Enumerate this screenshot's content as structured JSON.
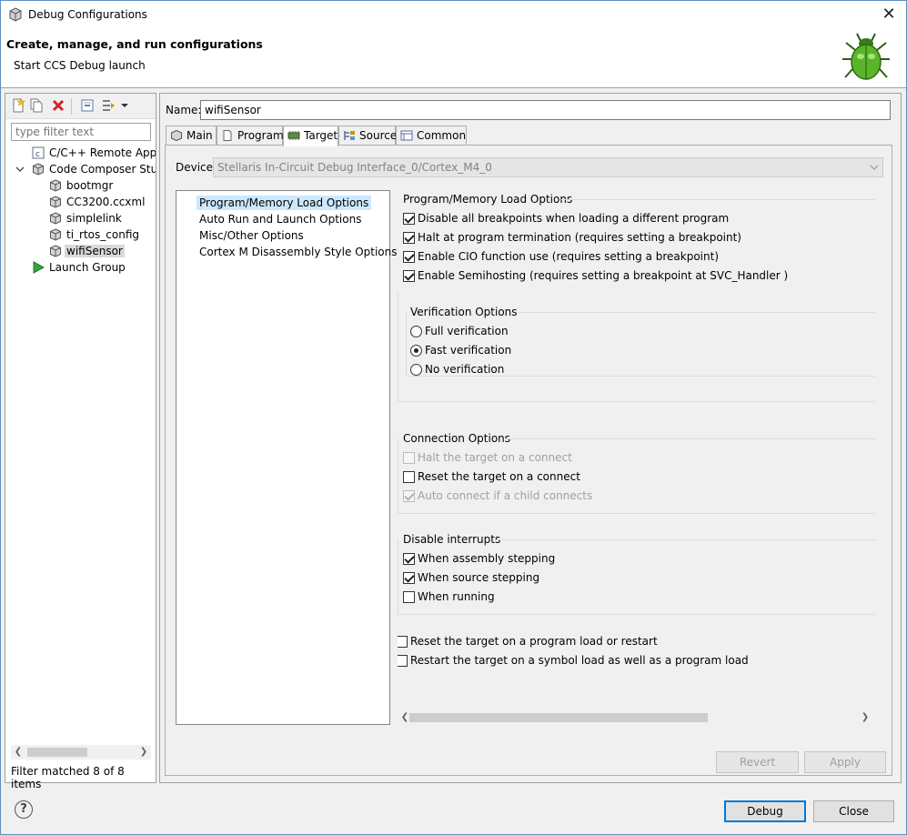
{
  "window": {
    "title": "Debug Configurations",
    "close_label": "✕"
  },
  "header": {
    "title": "Create, manage, and run configurations",
    "subtitle": "Start CCS Debug launch"
  },
  "left": {
    "filter_placeholder": "type filter text",
    "tree": [
      {
        "label": "C/C++ Remote Appli",
        "icon": "c-file-icon"
      },
      {
        "label": "Code Composer Stuc",
        "icon": "cube-icon",
        "expanded": true
      },
      {
        "label": "bootmgr",
        "icon": "cube-small-icon"
      },
      {
        "label": "CC3200.ccxml",
        "icon": "cube-small-icon"
      },
      {
        "label": "simplelink",
        "icon": "cube-small-icon"
      },
      {
        "label": "ti_rtos_config",
        "icon": "cube-small-icon"
      },
      {
        "label": "wifiSensor",
        "icon": "cube-small-icon",
        "selected": true
      },
      {
        "label": "Launch Group",
        "icon": "play-icon"
      }
    ],
    "status": "Filter matched 8 of 8 items"
  },
  "config": {
    "name_label": "Name:",
    "name_value": "wifiSensor",
    "tabs": [
      {
        "label": "Main"
      },
      {
        "label": "Program"
      },
      {
        "label": "Target",
        "active": true
      },
      {
        "label": "Source"
      },
      {
        "label": "Common"
      }
    ],
    "device_label": "Device",
    "device_value": "Stellaris In-Circuit Debug Interface_0/Cortex_M4_0",
    "option_categories": [
      "Program/Memory Load Options",
      "Auto Run and Launch Options",
      "Misc/Other Options",
      "Cortex M Disassembly Style Options"
    ],
    "load_group": {
      "title": "Program/Memory Load Options",
      "items": [
        {
          "label": "Disable all breakpoints when loading a different program",
          "checked": true
        },
        {
          "label": "Halt at program termination (requires setting a breakpoint)",
          "checked": true
        },
        {
          "label": "Enable CIO function use (requires setting a breakpoint)",
          "checked": true
        },
        {
          "label": "Enable Semihosting (requires setting a breakpoint at SVC_Handler )",
          "checked": true
        }
      ]
    },
    "verification": {
      "title": "Verification Options",
      "items": [
        {
          "label": "Full verification",
          "checked": false
        },
        {
          "label": "Fast verification",
          "checked": true
        },
        {
          "label": "No verification",
          "checked": false
        }
      ]
    },
    "connection": {
      "title": "Connection Options",
      "items": [
        {
          "label": "Halt the target on a connect",
          "checked": false,
          "disabled": true
        },
        {
          "label": "Reset the target on a connect",
          "checked": false,
          "disabled": false
        },
        {
          "label": "Auto connect if a child connects",
          "checked": true,
          "disabled": true
        }
      ]
    },
    "interrupts": {
      "title": "Disable interrupts",
      "items": [
        {
          "label": "When assembly stepping",
          "checked": true
        },
        {
          "label": "When source stepping",
          "checked": true
        },
        {
          "label": "When running",
          "checked": false
        }
      ]
    },
    "extra": [
      {
        "label": "Reset the target on a program load or restart",
        "checked": false
      },
      {
        "label": "Restart the target on a symbol load as well as a program load",
        "checked": false
      }
    ],
    "revert_label": "Revert",
    "apply_label": "Apply"
  },
  "footer": {
    "help_label": "?",
    "debug_label": "Debug",
    "close_label": "Close"
  },
  "colors": {
    "accent": "#0078d7",
    "selection": "#cce8ff",
    "bug_green": "#4caf1f"
  }
}
